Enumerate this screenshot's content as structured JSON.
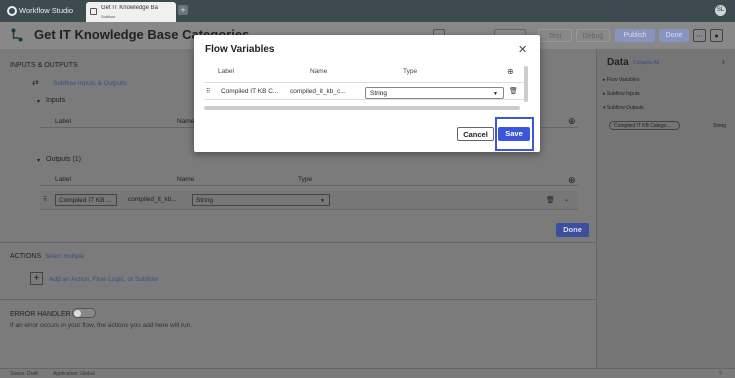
{
  "app": {
    "name": "Workflow Studio",
    "tab_title": "Get IT Knowledge Base",
    "tab_subtitle": "Subflow",
    "avatar": "SL"
  },
  "header": {
    "title": "Get IT Knowledge Base Categories",
    "buttons": {
      "test": "Test",
      "debug": "Debug",
      "publish": "Publish",
      "done": "Done"
    }
  },
  "left": {
    "section": "INPUTS & OUTPUTS",
    "subflow_link": "Subflow Inputs & Outputs",
    "inputs_label": "Inputs",
    "inputs_cols": [
      "Label",
      "Name"
    ],
    "outputs_label": "Outputs (1)",
    "outputs_cols": [
      "Label",
      "Name",
      "Type"
    ],
    "output_row": {
      "label": "Compiled IT KB ...",
      "name": "compiled_it_kb...",
      "type": "String"
    },
    "done": "Done",
    "actions": "ACTIONS",
    "select_multiple": "Select multiple",
    "add_action": "Add an Action, Flow Logic, or Subflow",
    "error_handler": "ERROR HANDLER",
    "error_text": "If an error occurs in your flow, the actions you add here will run."
  },
  "right": {
    "title": "Data",
    "collapse": "Collapse All",
    "items": [
      "Flow Variables",
      "Subflow Inputs",
      "Subflow Outputs"
    ],
    "pill": "Compiled IT KB Catego...",
    "pill_type": "String"
  },
  "status": {
    "status": "Status: Draft",
    "application": "Application: Global"
  },
  "modal": {
    "title": "Flow Variables",
    "cols": [
      "Label",
      "Name",
      "Type"
    ],
    "row": {
      "label": "Compiled IT KB C...",
      "name": "compiled_it_kb_c...",
      "type": "String"
    },
    "cancel": "Cancel",
    "save": "Save"
  },
  "colors": {
    "accent": "#3b57d9",
    "topbar": "#3d4a4f"
  }
}
